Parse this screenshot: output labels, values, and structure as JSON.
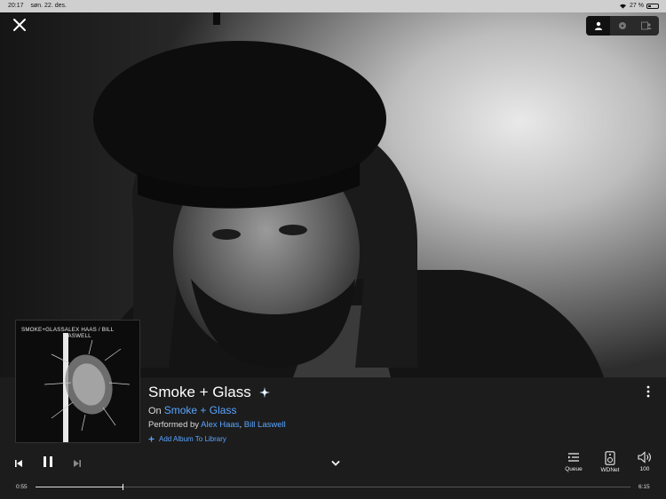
{
  "status_bar": {
    "time": "20:17",
    "date": "søn. 22. des.",
    "battery_text": "27 %",
    "battery_level": 0.27
  },
  "hero": {
    "photo_description_icon": "artist-photo"
  },
  "view_toggle": {
    "options": [
      "artist-icon",
      "album-icon",
      "credits-icon"
    ],
    "selected": "artist-icon"
  },
  "album_art": {
    "title": "SMOKE+GLASS",
    "artists": "ALEX HAAS / BILL LASWELL"
  },
  "track": {
    "title": "Smoke + Glass",
    "on_prefix": "On",
    "album": "Smoke + Glass",
    "performed_prefix": "Performed by",
    "artist1": "Alex Haas",
    "separator": ",",
    "artist2": "Bill Laswell",
    "add_album_label": "Add Album To Library"
  },
  "controls": {
    "queue_label": "Queue",
    "device_label": "WDNet",
    "volume_value": "100"
  },
  "playback": {
    "elapsed": "0:55",
    "total": "6:15",
    "progress": 0.147
  },
  "colors": {
    "accent": "#5aa5ff",
    "background": "#1c1c1c"
  }
}
